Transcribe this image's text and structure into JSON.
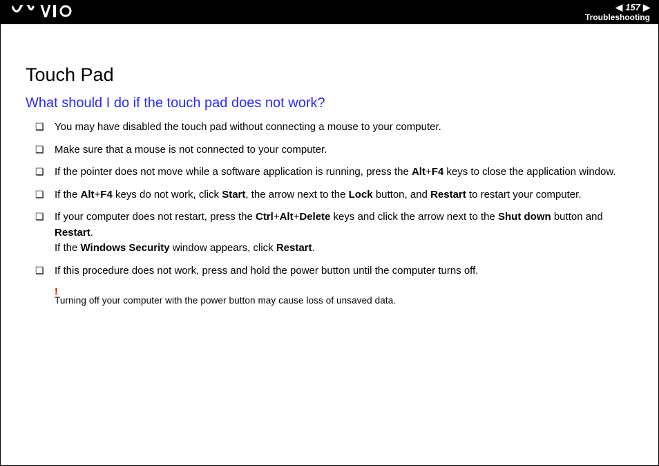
{
  "header": {
    "page_number": "157",
    "section": "Troubleshooting"
  },
  "page": {
    "title": "Touch Pad",
    "subtitle": "What should I do if the touch pad does not work?"
  },
  "bullets": [
    {
      "segments": [
        {
          "t": "You may have disabled the touch pad without connecting a mouse to your computer."
        }
      ]
    },
    {
      "segments": [
        {
          "t": "Make sure that a mouse is not connected to your computer."
        }
      ]
    },
    {
      "segments": [
        {
          "t": "If the pointer does not move while a software application is running, press the "
        },
        {
          "t": "Alt",
          "b": true
        },
        {
          "t": "+"
        },
        {
          "t": "F4",
          "b": true
        },
        {
          "t": " keys to close the application window."
        }
      ]
    },
    {
      "segments": [
        {
          "t": "If the "
        },
        {
          "t": "Alt",
          "b": true
        },
        {
          "t": "+"
        },
        {
          "t": "F4",
          "b": true
        },
        {
          "t": " keys do not work, click "
        },
        {
          "t": "Start",
          "b": true
        },
        {
          "t": ", the arrow next to the "
        },
        {
          "t": "Lock",
          "b": true
        },
        {
          "t": " button, and "
        },
        {
          "t": "Restart",
          "b": true
        },
        {
          "t": " to restart your computer."
        }
      ]
    },
    {
      "segments": [
        {
          "t": "If your computer does not restart, press the "
        },
        {
          "t": "Ctrl",
          "b": true
        },
        {
          "t": "+"
        },
        {
          "t": "Alt",
          "b": true
        },
        {
          "t": "+"
        },
        {
          "t": "Delete",
          "b": true
        },
        {
          "t": " keys and click the arrow next to the "
        },
        {
          "t": "Shut down",
          "b": true
        },
        {
          "t": " button and "
        },
        {
          "t": "Restart",
          "b": true
        },
        {
          "t": "."
        }
      ],
      "segments2": [
        {
          "t": "If the "
        },
        {
          "t": "Windows Security",
          "b": true
        },
        {
          "t": " window appears, click "
        },
        {
          "t": "Restart",
          "b": true
        },
        {
          "t": "."
        }
      ]
    },
    {
      "segments": [
        {
          "t": "If this procedure does not work, press and hold the power button until the computer turns off."
        }
      ]
    }
  ],
  "warning": {
    "mark": "!",
    "text": "Turning off your computer with the power button may cause loss of unsaved data."
  }
}
